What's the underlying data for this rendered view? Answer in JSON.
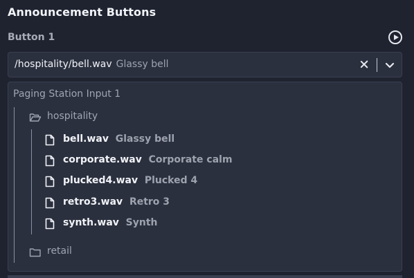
{
  "title": "Announcement Buttons",
  "button": {
    "label": "Button 1",
    "play_icon": "play-circle-icon",
    "selected_path": "/hospitality/bell.wav",
    "selected_desc": "Glassy bell"
  },
  "dropdown": {
    "group_label": "Paging Station Input 1",
    "folders": [
      {
        "name": "hospitality",
        "icon": "folder-open-icon",
        "files": [
          {
            "name": "bell.wav",
            "desc": "Glassy bell"
          },
          {
            "name": "corporate.wav",
            "desc": "Corporate calm"
          },
          {
            "name": "plucked4.wav",
            "desc": "Plucked 4"
          },
          {
            "name": "retro3.wav",
            "desc": "Retro 3"
          },
          {
            "name": "synth.wav",
            "desc": "Synth"
          }
        ]
      },
      {
        "name": "retail",
        "icon": "folder-icon",
        "files": []
      }
    ]
  },
  "colors": {
    "background": "#1f2330",
    "surface": "#2b303f",
    "text": "#f1f3f7",
    "muted": "#9ea3af"
  }
}
